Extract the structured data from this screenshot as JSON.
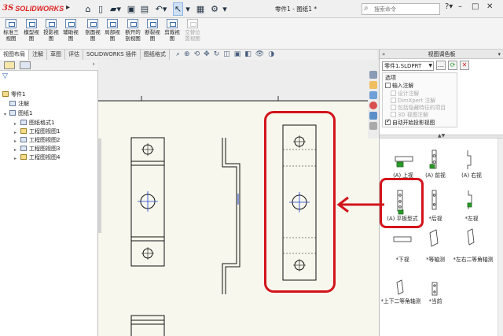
{
  "app": {
    "logo_ds": "3S",
    "logo_text": "SOLIDWORKS",
    "title": "零件1 - 图纸1 *",
    "search_placeholder": "搜索命令"
  },
  "toolbar": {
    "commands": [
      {
        "label": "标准三视图",
        "disabled": false
      },
      {
        "label": "模型视图",
        "disabled": false
      },
      {
        "label": "投影视图",
        "disabled": false
      },
      {
        "label": "辅助视图",
        "disabled": false
      },
      {
        "label": "剖面视图",
        "disabled": false
      },
      {
        "label": "局部视图",
        "disabled": false
      },
      {
        "label": "断开的剖视图",
        "disabled": false
      },
      {
        "label": "断裂视图",
        "disabled": false
      },
      {
        "label": "剪裁视图",
        "disabled": false
      },
      {
        "label": "交替位置视图",
        "disabled": true
      }
    ]
  },
  "tabs": [
    "视图布局",
    "注解",
    "草图",
    "评估",
    "SOLIDWORKS 插件",
    "图纸格式"
  ],
  "tree": {
    "root": "零件1",
    "items": [
      {
        "label": "注解",
        "level": 1
      },
      {
        "label": "图纸1",
        "level": 1
      },
      {
        "label": "图纸格式1",
        "level": 2
      },
      {
        "label": "工程图视图1",
        "level": 2
      },
      {
        "label": "工程图视图2",
        "level": 2
      },
      {
        "label": "工程图视图3",
        "level": 2
      },
      {
        "label": "工程图视图4",
        "level": 2
      }
    ]
  },
  "palette": {
    "title": "视图调色板",
    "part_select": "零件1.SLDPRT",
    "options_title": "选项",
    "options": [
      {
        "label": "输入注解",
        "checked": false,
        "enabled": true
      },
      {
        "label": "设计注解",
        "checked": false,
        "enabled": false
      },
      {
        "label": "DimXpert 注解",
        "checked": false,
        "enabled": false
      },
      {
        "label": "包括隐藏特征的项目",
        "checked": false,
        "enabled": false
      },
      {
        "label": "3D 视图注解",
        "checked": false,
        "enabled": false
      },
      {
        "label": "自动开始投影视图",
        "checked": true,
        "enabled": true
      }
    ],
    "views": [
      {
        "label": "(A) 上视"
      },
      {
        "label": "(A) 前视"
      },
      {
        "label": "(A) 右视"
      },
      {
        "label": "(A) 平板型式"
      },
      {
        "label": "*后视"
      },
      {
        "label": "*左视"
      },
      {
        "label": "*下视"
      },
      {
        "label": "*等轴测"
      },
      {
        "label": "*左右二等角轴测"
      },
      {
        "label": "*上下二等角轴测"
      },
      {
        "label": "*当前"
      }
    ]
  },
  "colors": {
    "annotation_red": "#d3131b",
    "logo_red": "#dd2222",
    "center_blue": "#1d3fd0"
  }
}
